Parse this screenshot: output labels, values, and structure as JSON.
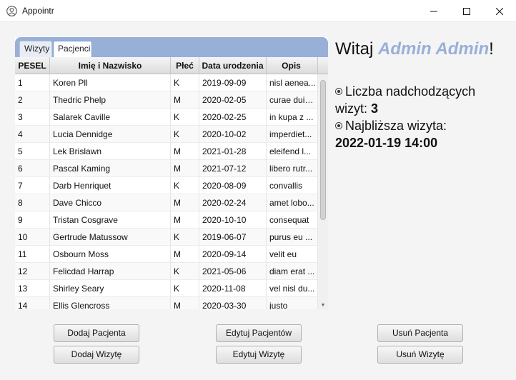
{
  "window": {
    "title": "Appointr"
  },
  "tabs": [
    {
      "label": "Wizyty"
    },
    {
      "label": "Pacjenci"
    }
  ],
  "table": {
    "columns": [
      "PESEL",
      "Imię i Nazwisko",
      "Płeć",
      "Data urodzenia",
      "Opis"
    ],
    "rows": [
      [
        "1",
        "Koren Pll",
        "K",
        "2019-09-09",
        "nisl aenea..."
      ],
      [
        "2",
        "Thedric Phelp",
        "M",
        "2020-02-05",
        "curae duis..."
      ],
      [
        "3",
        "Salarek Caville",
        "K",
        "2020-02-25",
        "in kupa z ..."
      ],
      [
        "4",
        "Lucia Dennidge",
        "K",
        "2020-10-02",
        "imperdiet..."
      ],
      [
        "5",
        "Lek Brislawn",
        "M",
        "2021-01-28",
        "eleifend l..."
      ],
      [
        "6",
        "Pascal Kaming",
        "M",
        "2021-07-12",
        "libero rutr..."
      ],
      [
        "7",
        "Darb Henriquet",
        "K",
        "2020-08-09",
        "convallis"
      ],
      [
        "8",
        "Dave Chicco",
        "M",
        "2020-02-24",
        "amet lobo..."
      ],
      [
        "9",
        "Tristan Cosgrave",
        "M",
        "2020-10-10",
        "consequat"
      ],
      [
        "10",
        "Gertrude Matussow",
        "K",
        "2019-06-07",
        "purus eu ..."
      ],
      [
        "11",
        "Osbourn Moss",
        "M",
        "2020-09-14",
        "velit eu"
      ],
      [
        "12",
        "Felicdad Harrap",
        "K",
        "2021-05-06",
        "diam erat ..."
      ],
      [
        "13",
        "Shirley Seary",
        "K",
        "2020-11-08",
        "vel nisl du..."
      ],
      [
        "14",
        "Ellis Glencross",
        "M",
        "2020-03-30",
        "justo"
      ]
    ]
  },
  "welcome": {
    "prefix": "Witaj ",
    "name": "Admin Admin",
    "suffix": "!"
  },
  "info": {
    "upcoming_label": "Liczba nadchodzących",
    "upcoming_label2": "wizyt: ",
    "upcoming_value": "3",
    "next_label": "Najbliższa wizyta:",
    "next_value": "2022-01-19 14:00"
  },
  "buttons": {
    "add_patient": "Dodaj Pacjenta",
    "add_visit": "Dodaj Wizytę",
    "edit_patients": "Edytuj Pacjentów",
    "edit_visit": "Edytuj Wizytę",
    "delete_patient": "Usuń Pacjenta",
    "delete_visit": "Usuń Wizytę"
  }
}
